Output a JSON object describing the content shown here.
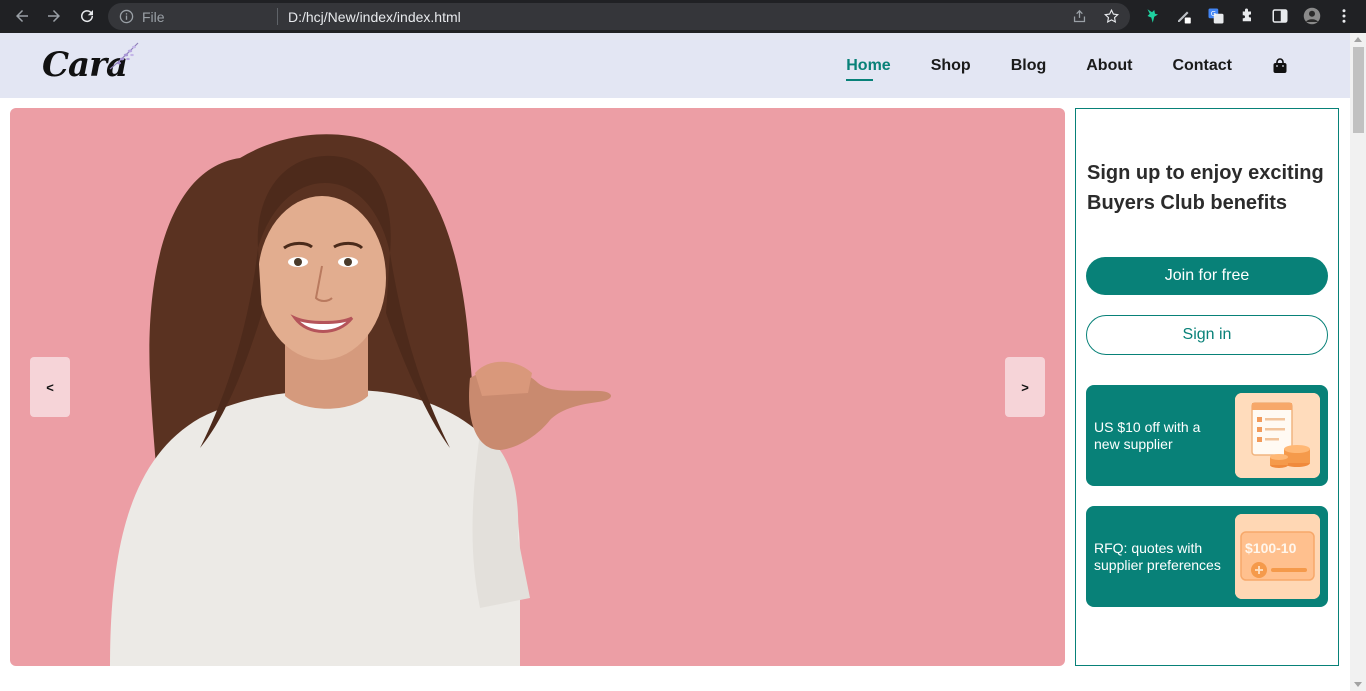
{
  "browser": {
    "file_label": "File",
    "url": "D:/hcj/New/index/index.html"
  },
  "header": {
    "logo_text": "Cara",
    "nav": [
      {
        "label": "Home",
        "active": true
      },
      {
        "label": "Shop",
        "active": false
      },
      {
        "label": "Blog",
        "active": false
      },
      {
        "label": "About",
        "active": false
      },
      {
        "label": "Contact",
        "active": false
      }
    ],
    "cart_icon": "shopping-bag-icon"
  },
  "hero": {
    "prev_label": "<",
    "next_label": ">",
    "background_color": "#ec9ea5"
  },
  "side_panel": {
    "heading": "Sign up to enjoy exciting Buyers Club benefits",
    "join_label": "Join for free",
    "signin_label": "Sign in",
    "promos": [
      {
        "text": "US $10 off with a new supplier",
        "icon": "order-list-coins-icon"
      },
      {
        "text": "RFQ: quotes with supplier preferences",
        "icon": "coupon-icon",
        "badge": "$100-10"
      }
    ]
  },
  "colors": {
    "accent": "#088178",
    "header_bg": "#e3e6f3",
    "text_dark": "#1a1a1a"
  }
}
